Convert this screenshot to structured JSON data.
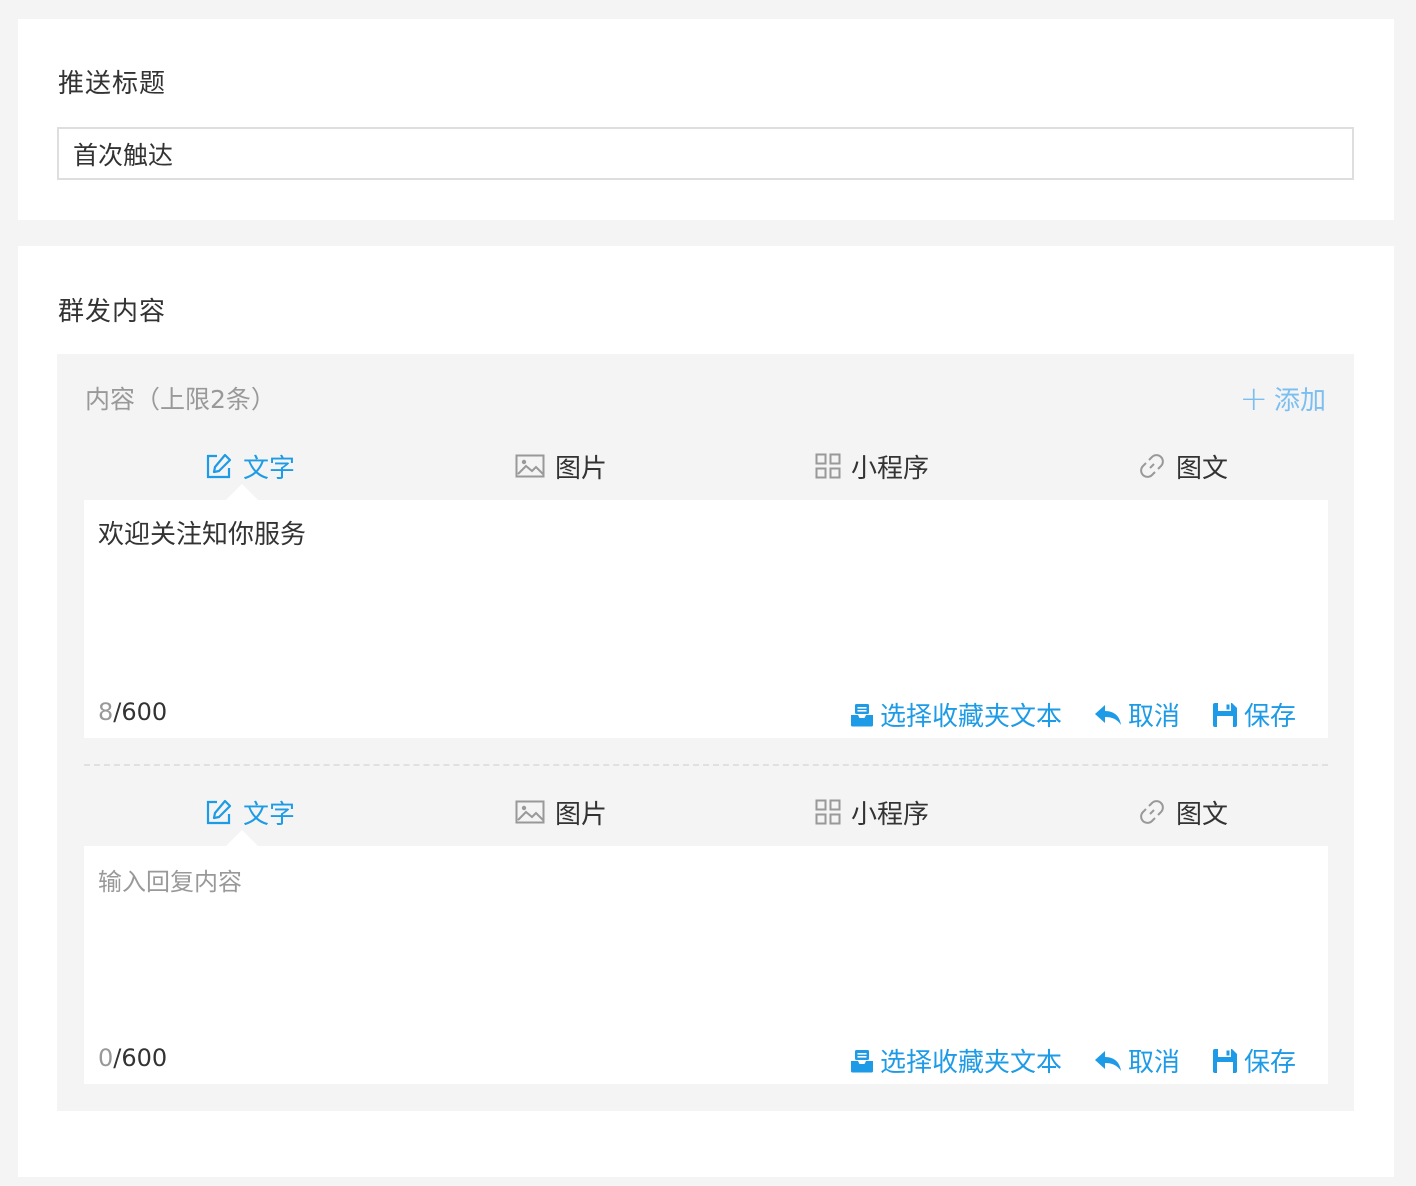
{
  "push_title": {
    "label": "推送标题",
    "value": "首次触达"
  },
  "broadcast": {
    "label": "群发内容",
    "content_header": "内容（上限2条）",
    "add_label": "添加",
    "tabs": [
      "文字",
      "图片",
      "小程序",
      "图文"
    ],
    "items": [
      {
        "text": "欢迎关注知你服务",
        "placeholder": "",
        "count": "8",
        "max": "/600"
      },
      {
        "text": "",
        "placeholder": "输入回复内容",
        "count": "0",
        "max": "/600"
      }
    ],
    "actions": {
      "select_favorite": "选择收藏夹文本",
      "cancel": "取消",
      "save": "保存"
    }
  },
  "colors": {
    "accent": "#1e9be6",
    "add_link": "#7bbef0",
    "background": "#f4f4f4"
  }
}
